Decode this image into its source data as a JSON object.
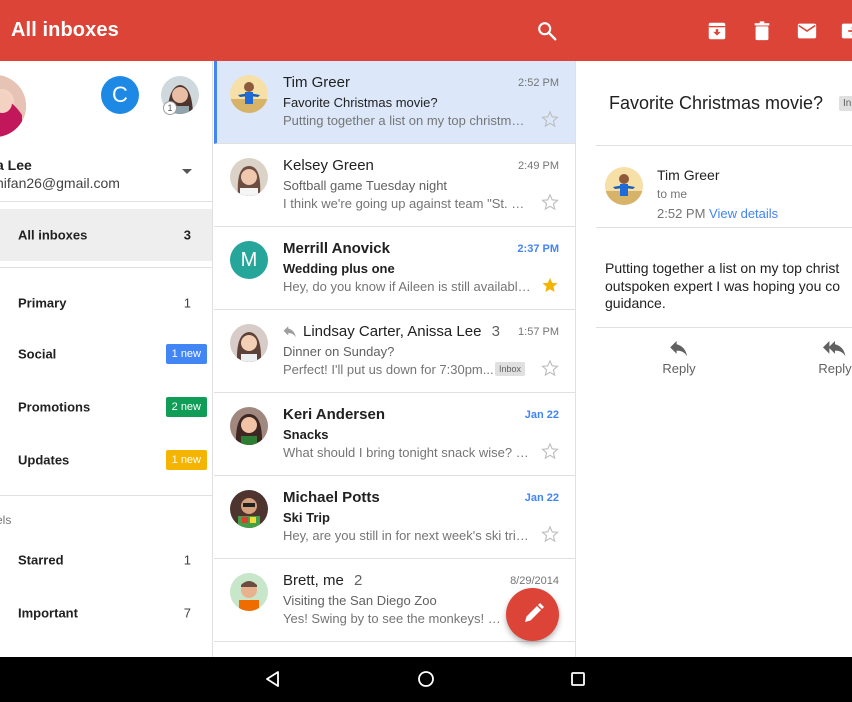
{
  "appbar": {
    "title": "All inboxes",
    "icons": [
      "search-icon",
      "archive-icon",
      "delete-icon",
      "mail-icon",
      "move-icon"
    ],
    "color": "#db4437"
  },
  "drawer": {
    "account_name": "a Lee",
    "account_email": "nifan26@gmail.com",
    "other_account_initial": "C",
    "other_account_badge": "1",
    "items": [
      {
        "label": "All inboxes",
        "count": "3"
      },
      {
        "label": "Primary",
        "count": "1"
      },
      {
        "label": "Social",
        "pill": "1 new",
        "pill_color": "#4285f4"
      },
      {
        "label": "Promotions",
        "pill": "2 new",
        "pill_color": "#0f9d58"
      },
      {
        "label": "Updates",
        "pill": "1 new",
        "pill_color": "#f4b400"
      }
    ],
    "labels_header": "els",
    "label_items": [
      {
        "label": "Starred",
        "count": "1"
      },
      {
        "label": "Important",
        "count": "7"
      }
    ]
  },
  "messages": [
    {
      "sender": "Tim Greer",
      "time": "2:52 PM",
      "subject": "Favorite Christmas movie?",
      "snippet": "Putting together a list on my top christmas...",
      "starred": false
    },
    {
      "sender": "Kelsey Green",
      "time": "2:49 PM",
      "subject": "Softball game Tuesday night",
      "snippet": "I think we're going up against team \"St. El...",
      "starred": false
    },
    {
      "sender": "Merrill Anovick",
      "time": "2:37 PM",
      "subject": "Wedding plus one",
      "snippet": "Hey, do you know if Aileen is still available...",
      "starred": true,
      "avatar_initial": "M"
    },
    {
      "sender": "Lindsay Carter, Anissa Lee",
      "thread_count": "3",
      "time": "1:57 PM",
      "subject": "Dinner on Sunday?",
      "snippet": "Perfect! I'll put us down for 7:30pm...",
      "chip": "Inbox",
      "starred": false
    },
    {
      "sender": "Keri Andersen",
      "time": "Jan 22",
      "subject": "Snacks",
      "snippet": "What should I bring tonight snack wise? I t...",
      "starred": false
    },
    {
      "sender": "Michael Potts",
      "time": "Jan 22",
      "subject": "Ski Trip",
      "snippet": "Hey, are you still in for next week's ski trip?...",
      "starred": false
    },
    {
      "sender": "Brett, me",
      "thread_count": "2",
      "time": "8/29/2014",
      "subject": "Visiting the San Diego Zoo",
      "snippet": "Yes! Swing by to see the monkeys! On F...",
      "starred": false
    }
  ],
  "pane": {
    "subject": "Favorite Christmas movie?",
    "label_chip": "In",
    "from": "Tim Greer",
    "to": "to me",
    "time": "2:52 PM",
    "details_link": "View details",
    "body_lines": [
      "Putting together a list on my top christ",
      "outspoken expert I was hoping you co",
      "guidance."
    ],
    "reply_label": "Reply",
    "reply_all_label": "Reply"
  }
}
